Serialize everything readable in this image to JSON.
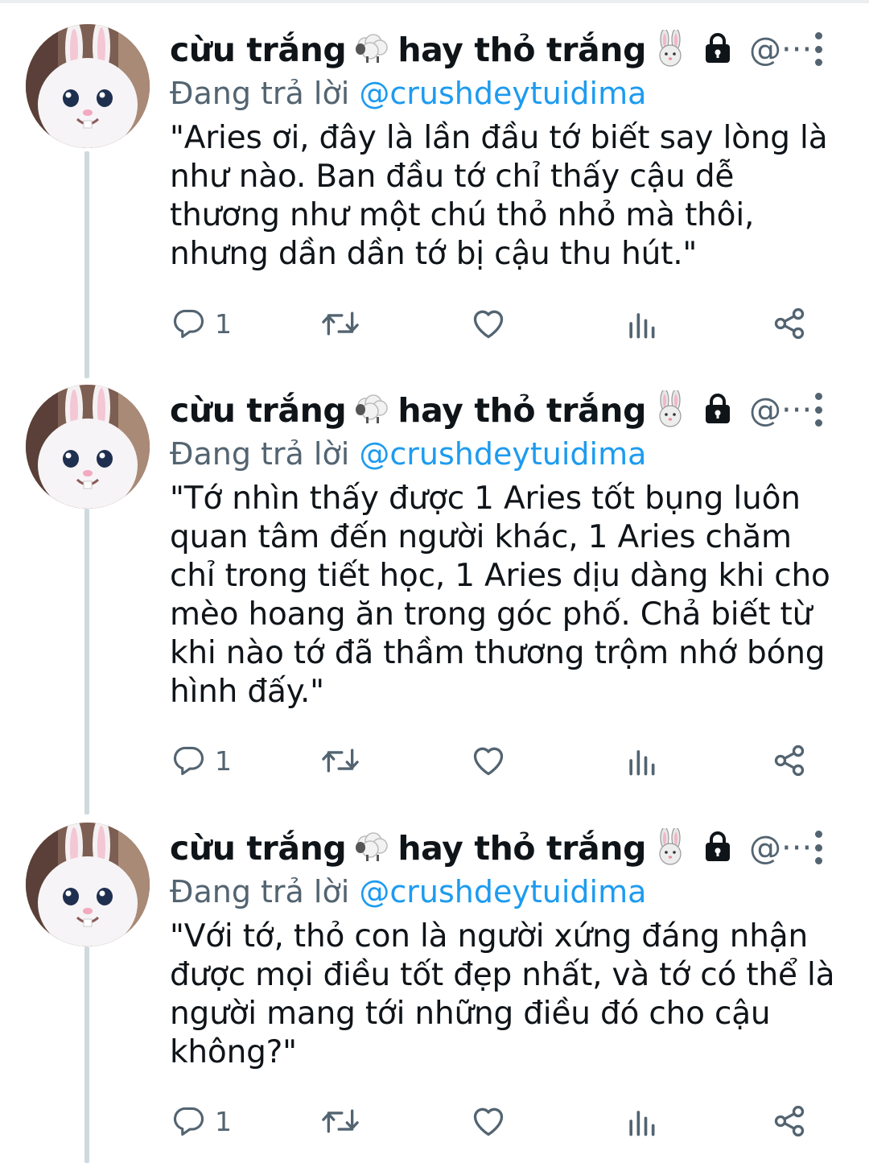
{
  "tweets": [
    {
      "display_name": "cừu trắng",
      "display_name_2": "hay thỏ trắng",
      "handle": "@···",
      "replying_prefix": "Đang trả lời",
      "replying_to": "@crushdeytuidima",
      "text": "\"Aries ơi, đây là lần đầu tớ biết say lòng là như nào. Ban đầu tớ chỉ thấy cậu dễ thương như một chú thỏ nhỏ mà thôi, nhưng dần dần tớ bị cậu thu hút.\"",
      "reply_count": "1",
      "icons": [
        "sheep-icon",
        "rabbit-icon",
        "lock-icon"
      ]
    },
    {
      "display_name": "cừu trắng",
      "display_name_2": "hay thỏ trắng",
      "handle": "@···",
      "replying_prefix": "Đang trả lời",
      "replying_to": "@crushdeytuidima",
      "text": "\"Tớ nhìn thấy được 1 Aries tốt bụng luôn quan tâm đến người khác, 1 Aries chăm chỉ trong tiết học, 1 Aries dịu dàng khi cho mèo hoang ăn trong góc phố. Chả biết từ khi nào tớ đã thầm thương trộm nhớ bóng hình đấy.\"",
      "reply_count": "1",
      "icons": [
        "sheep-icon",
        "rabbit-icon",
        "lock-icon"
      ]
    },
    {
      "display_name": "cừu trắng",
      "display_name_2": "hay thỏ trắng",
      "handle": "@···",
      "replying_prefix": "Đang trả lời",
      "replying_to": "@crushdeytuidima",
      "text": "\"Với tớ, thỏ con là người xứng đáng nhận được mọi điều tốt đẹp nhất, và tớ có thể là người mang tới những điều đó cho cậu không?\"",
      "reply_count": "1",
      "icons": [
        "sheep-icon",
        "rabbit-icon",
        "lock-icon"
      ]
    }
  ],
  "colors": {
    "text": "#0f1419",
    "secondary": "#536471",
    "accent": "#1d9bf0",
    "thread_line": "#cfd9de"
  }
}
